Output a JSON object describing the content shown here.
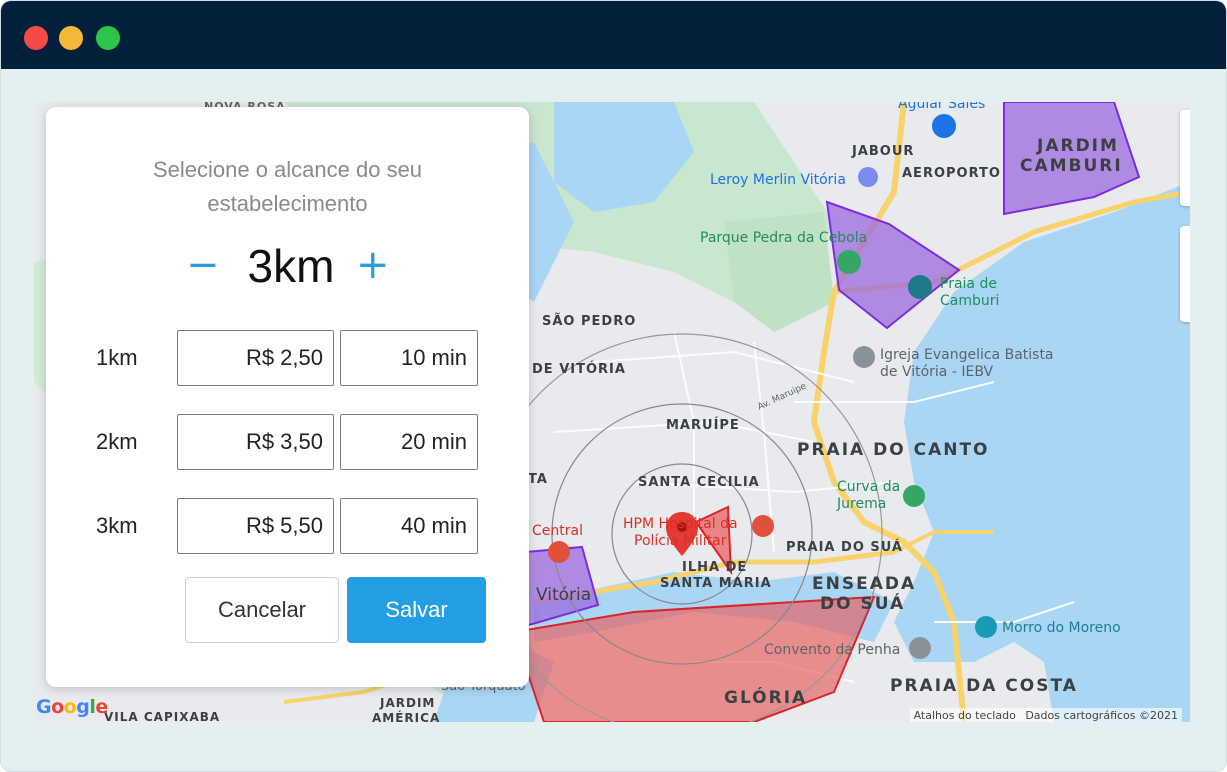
{
  "window": {
    "controls": [
      "close",
      "minimize",
      "maximize"
    ]
  },
  "panel": {
    "title_line1": "Selecione o alcance do seu",
    "title_line2": "estabelecimento",
    "stepper": {
      "minus": "−",
      "value": "3km",
      "plus": "+"
    },
    "rows": [
      {
        "label": "1km",
        "price": "R$ 2,50",
        "time": "10 min"
      },
      {
        "label": "2km",
        "price": "R$ 3,50",
        "time": "20 min"
      },
      {
        "label": "3km",
        "price": "R$ 5,50",
        "time": "40 min"
      }
    ],
    "cancel_label": "Cancelar",
    "save_label": "Salvar"
  },
  "map": {
    "labels": {
      "nova_rosa": "NOVA ROSA",
      "aguiar_sales": "Aguiar Sales",
      "jabour": "JABOUR",
      "aeroporto": "AEROPORTO",
      "jardim_camburi": "JARDIM",
      "jardim_camburi2": "CAMBURI",
      "leroy": "Leroy Merlin Vitória",
      "parque": "Parque Pedra da Cebola",
      "praia_camburi": "Praia de",
      "praia_camburi2": "Camburi",
      "sao_pedro": "SÃO PEDRO",
      "igreja": "Igreja Evangelica Batista",
      "igreja2": "de Vitória - IEBV",
      "de_vitoria": "DE VITÓRIA",
      "maruipe": "MARUÍPE",
      "praia_canto": "PRAIA DO CANTO",
      "curva": "Curva da",
      "curva2": "Jurema",
      "santa_cecilia": "SANTA CECILIA",
      "ta": "TA",
      "central": "Central",
      "hpm": "HPM Hospital da",
      "hpm2": "Polícia Militar",
      "praia_sua": "PRAIA DO SUÁ",
      "ilha": "ILHA DE",
      "ilha2": "SANTA MARIA",
      "vitoria": "Vitória",
      "enseada": "ENSEADA",
      "enseada2": "DO SUÁ",
      "morro": "Morro do Moreno",
      "convento": "Convento da Penha",
      "sao_torquato": "São Torquato",
      "vila_capixaba": "VILA CAPIXABA",
      "jardim_america": "JARDIM",
      "jardim_america2": "AMÉRICA",
      "gloria": "GLÓRIA",
      "praia_costa": "PRAIA DA COSTA",
      "av_maruipe": "Av. Maruipe"
    },
    "google": "Google",
    "attribution_shortcuts": "Atalhos do teclado",
    "attribution_data": "Dados cartográficos ©2021"
  }
}
